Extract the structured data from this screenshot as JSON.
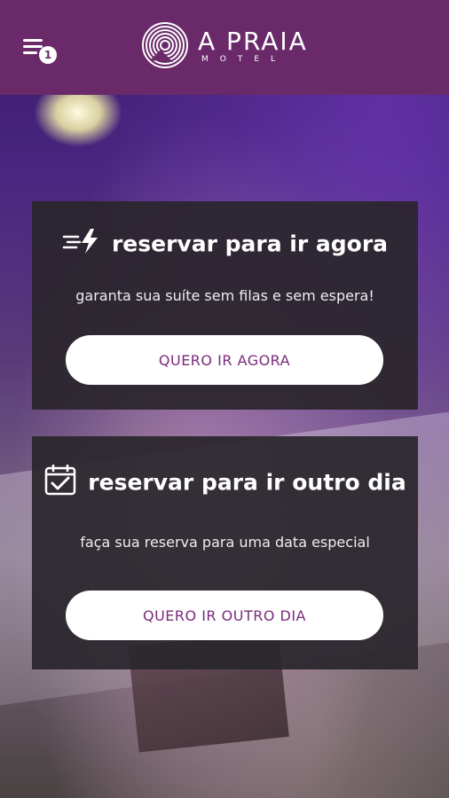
{
  "header": {
    "menu_badge": "1",
    "logo_title": "A PRAIA",
    "logo_subtitle": "MOTEL"
  },
  "cards": [
    {
      "icon": "lightning-bolt-icon",
      "title": "reservar para ir agora",
      "subtitle": "garanta sua suíte sem filas e sem espera!",
      "button_label": "QUERO IR AGORA"
    },
    {
      "icon": "calendar-check-icon",
      "title": "reservar para ir outro dia",
      "subtitle": "faça sua reserva para uma data especial",
      "button_label": "QUERO IR OUTRO DIA"
    }
  ],
  "colors": {
    "header_bg": "#6a2a6a",
    "button_text": "#7a2a7a",
    "card_bg": "#2a262c"
  }
}
